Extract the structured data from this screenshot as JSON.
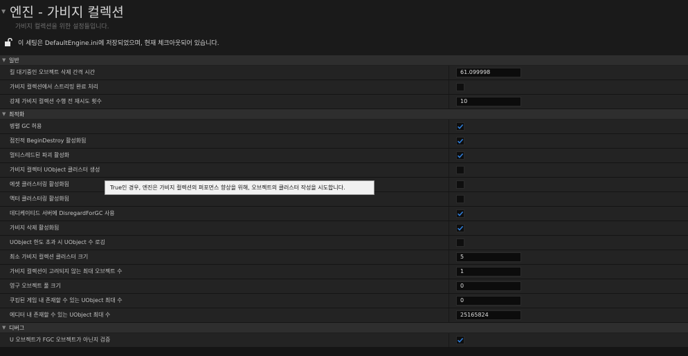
{
  "header": {
    "title": "엔진 - 가비지 컬렉션",
    "subtitle": "가비지 컬렉션을 위한 설정들입니다.",
    "notice": "이 세팅은 DefaultEngine.ini에 저장되었으며, 현재 체크아웃되어 있습니다."
  },
  "sections": {
    "general": {
      "label": "일반",
      "rows": [
        {
          "label": "킬 대기중인 오브젝트 삭제 간격 시간",
          "value": "61.099998"
        },
        {
          "label": "가비지 컬렉션에서 스트리밍 완료 처리",
          "checked": false
        },
        {
          "label": "강제 가비지 컬렉션 수행 전 재시도 횟수",
          "value": "10"
        }
      ]
    },
    "optimization": {
      "label": "최적화",
      "rows": [
        {
          "label": "병렬 GC 허용",
          "checked": true
        },
        {
          "label": "점진적 BeginDestroy 활성화됨",
          "checked": true
        },
        {
          "label": "멀티스레드된 파괴 활성화",
          "checked": true
        },
        {
          "label": "가비지 컬렉터 UObject 클러스터 생성",
          "checked": false
        },
        {
          "label": "에셋 클러스터링 활성화됨",
          "checked": false
        },
        {
          "label": "액터 클러스터링 활성화됨",
          "checked": false
        },
        {
          "label": "데디케이티드 서버에 DisregardForGC 사용",
          "checked": true
        },
        {
          "label": "가비지 삭제 활성화됨",
          "checked": true
        },
        {
          "label": "UObject 한도 초과 시 UObject 수 로깅",
          "checked": false
        },
        {
          "label": "최소 가비지 컬렉션 클러스터 크기",
          "value": "5"
        },
        {
          "label": "가비지 컬렉션이 고려되지 않는 최대 오브젝트 수",
          "value": "1"
        },
        {
          "label": "영구 오브젝트 풀 크기",
          "value": "0"
        },
        {
          "label": "쿠킹된 게임 내 존재할 수 있는 UObject 최대 수",
          "value": "0"
        },
        {
          "label": "에디터 내 존재할 수 있는 UObject 최대 수",
          "value": "25165824"
        }
      ]
    },
    "debug": {
      "label": "디버그",
      "rows": [
        {
          "label": "U 오브젝트가 FGC 오브젝트가 아닌지 검증",
          "checked": true
        }
      ]
    }
  },
  "tooltip": "True인 경우, 엔진은 가비지 컬렉션의 퍼포먼스 향상을 위해, 오브젝트의 클러스터 작성을 시도합니다.",
  "colors": {
    "check": "#2f7fdc",
    "background": "#151515",
    "row": "#232323",
    "category": "#2e2e2e"
  },
  "icons": {
    "lock": "unlocked-padlock-icon",
    "checkmark": "checkmark-icon",
    "collapse": "triangle-down-icon"
  }
}
